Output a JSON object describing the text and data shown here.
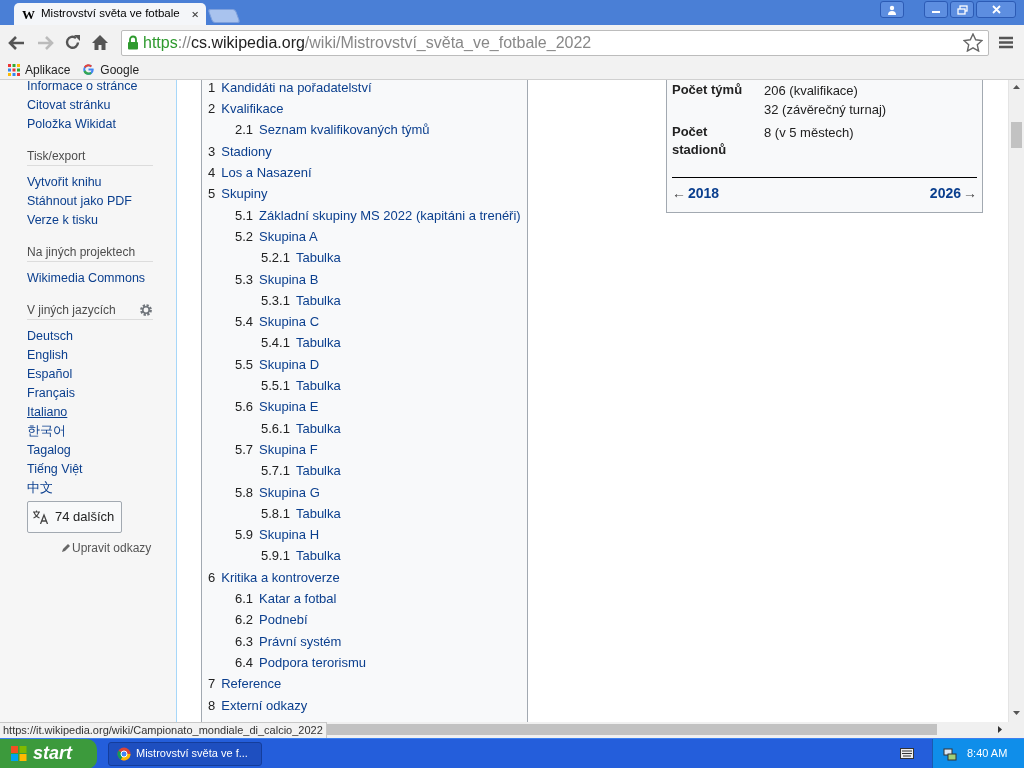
{
  "browser": {
    "favicon": "W",
    "tab_title": "Mistrovství světa ve fotbale",
    "url": {
      "scheme": "https",
      "separator": "://",
      "host": "cs.wikipedia.org",
      "path": "/wiki/Mistrovství_světa_ve_fotbale_2022"
    },
    "bookmarks": [
      {
        "kind": "apps",
        "label": "Aplikace"
      },
      {
        "kind": "google",
        "label": "Google"
      }
    ]
  },
  "sidebar": {
    "sections": [
      {
        "items": [
          {
            "label": "Informace o stránce",
            "hovered": false
          },
          {
            "label": "Citovat stránku",
            "hovered": false
          },
          {
            "label": "Položka Wikidat",
            "hovered": false
          }
        ]
      },
      {
        "heading": "Tisk/export",
        "items": [
          {
            "label": "Vytvořit knihu",
            "hovered": false
          },
          {
            "label": "Stáhnout jako PDF",
            "hovered": false
          },
          {
            "label": "Verze k tisku",
            "hovered": false
          }
        ]
      },
      {
        "heading": "Na jiných projektech",
        "items": [
          {
            "label": "Wikimedia Commons",
            "hovered": false
          }
        ]
      },
      {
        "heading": "V jiných jazycích",
        "settings": true,
        "items": [
          {
            "label": "Deutsch",
            "hovered": false
          },
          {
            "label": "English",
            "hovered": false
          },
          {
            "label": "Español",
            "hovered": false
          },
          {
            "label": "Français",
            "hovered": false
          },
          {
            "label": "Italiano",
            "hovered": true
          },
          {
            "label": "한국어",
            "hovered": false
          },
          {
            "label": "Tagalog",
            "hovered": false
          },
          {
            "label": "Tiếng Việt",
            "hovered": false
          },
          {
            "label": "中文",
            "hovered": false
          }
        ]
      }
    ],
    "more_languages": "74 dalších",
    "edit_links": "Upravit odkazy"
  },
  "toc": [
    {
      "number": "1",
      "text": "Kandidáti na pořadatelství"
    },
    {
      "number": "2",
      "text": "Kvalifikace",
      "children": [
        {
          "number": "2.1",
          "text": "Seznam kvalifikovaných týmů"
        }
      ]
    },
    {
      "number": "3",
      "text": "Stadiony"
    },
    {
      "number": "4",
      "text": "Los a Nasazení"
    },
    {
      "number": "5",
      "text": "Skupiny",
      "children": [
        {
          "number": "5.1",
          "text": "Základní skupiny MS 2022 (kapitáni a trenéři)"
        },
        {
          "number": "5.2",
          "text": "Skupina A",
          "children": [
            {
              "number": "5.2.1",
              "text": "Tabulka"
            }
          ]
        },
        {
          "number": "5.3",
          "text": "Skupina B",
          "children": [
            {
              "number": "5.3.1",
              "text": "Tabulka"
            }
          ]
        },
        {
          "number": "5.4",
          "text": "Skupina C",
          "children": [
            {
              "number": "5.4.1",
              "text": "Tabulka"
            }
          ]
        },
        {
          "number": "5.5",
          "text": "Skupina D",
          "children": [
            {
              "number": "5.5.1",
              "text": "Tabulka"
            }
          ]
        },
        {
          "number": "5.6",
          "text": "Skupina E",
          "children": [
            {
              "number": "5.6.1",
              "text": "Tabulka"
            }
          ]
        },
        {
          "number": "5.7",
          "text": "Skupina F",
          "children": [
            {
              "number": "5.7.1",
              "text": "Tabulka"
            }
          ]
        },
        {
          "number": "5.8",
          "text": "Skupina G",
          "children": [
            {
              "number": "5.8.1",
              "text": "Tabulka"
            }
          ]
        },
        {
          "number": "5.9",
          "text": "Skupina H",
          "children": [
            {
              "number": "5.9.1",
              "text": "Tabulka"
            }
          ]
        }
      ]
    },
    {
      "number": "6",
      "text": "Kritika a kontroverze",
      "children": [
        {
          "number": "6.1",
          "text": "Katar a fotbal"
        },
        {
          "number": "6.2",
          "text": "Podnebí"
        },
        {
          "number": "6.3",
          "text": "Právní systém"
        },
        {
          "number": "6.4",
          "text": "Podpora terorismu"
        }
      ]
    },
    {
      "number": "7",
      "text": "Reference"
    },
    {
      "number": "8",
      "text": "Externí odkazy"
    }
  ],
  "infobox": {
    "rows": [
      {
        "label": "Počet týmů",
        "values": [
          "206 (kvalifikace)",
          "32 (závěrečný turnaj)"
        ]
      },
      {
        "label": "Počet stadionů",
        "values": [
          "8 (v 5 městech)"
        ]
      }
    ],
    "prev": {
      "arrow": "←",
      "year": "2018"
    },
    "next": {
      "year": "2026",
      "arrow": "→"
    }
  },
  "status_bar": "https://it.wikipedia.org/wiki/Campionato_mondiale_di_calcio_2022",
  "taskbar": {
    "start": "start",
    "tasks": [
      "Mistrovství světa ve f..."
    ],
    "clock": "8:40 AM"
  }
}
